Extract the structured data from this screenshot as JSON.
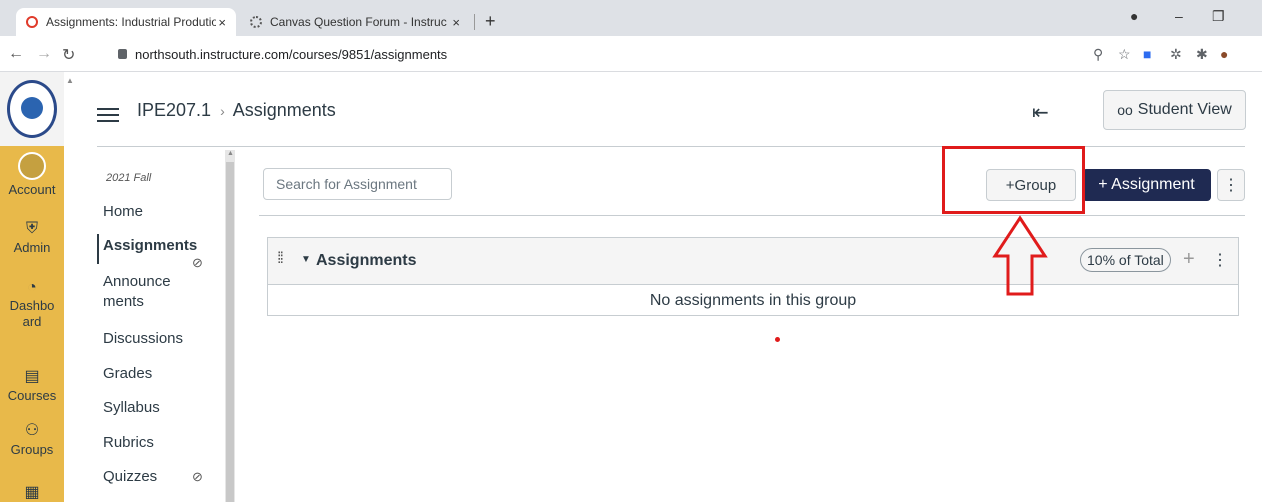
{
  "browser": {
    "tabs": [
      {
        "title": "Assignments: Industrial Prodution",
        "close": "×"
      },
      {
        "title": "Canvas Question Forum - Instruc",
        "close": "×"
      }
    ],
    "new_tab": "+",
    "url": "northsouth.instructure.com/courses/9851/assignments"
  },
  "global_nav": {
    "items": [
      {
        "label": "Account",
        "icon": "user-avatar-icon"
      },
      {
        "label": "Admin",
        "icon": "shield-icon"
      },
      {
        "label": "Dashbo ard",
        "icon": "dashboard-icon"
      },
      {
        "label": "Courses",
        "icon": "book-icon"
      },
      {
        "label": "Groups",
        "icon": "people-icon"
      },
      {
        "label": "",
        "icon": "calendar-icon"
      }
    ]
  },
  "header": {
    "course": "IPE207.1",
    "separator": "›",
    "page": "Assignments",
    "student_view": "Student View"
  },
  "course_nav": {
    "term": "2021 Fall",
    "items": [
      {
        "label": "Home"
      },
      {
        "label": "Assignments"
      },
      {
        "label": "Announce ments"
      },
      {
        "label": "Discussions"
      },
      {
        "label": "Grades"
      },
      {
        "label": "Syllabus"
      },
      {
        "label": "Rubrics"
      },
      {
        "label": "Quizzes"
      }
    ]
  },
  "main": {
    "search_placeholder": "Search for Assignment",
    "group_button": "+Group",
    "assignment_button": "+ Assignment",
    "more_button": "⋮",
    "group": {
      "title": "Assignments",
      "percent": "10% of Total",
      "empty_text": "No assignments in this group"
    }
  },
  "annotation_color": "#e01b1b"
}
